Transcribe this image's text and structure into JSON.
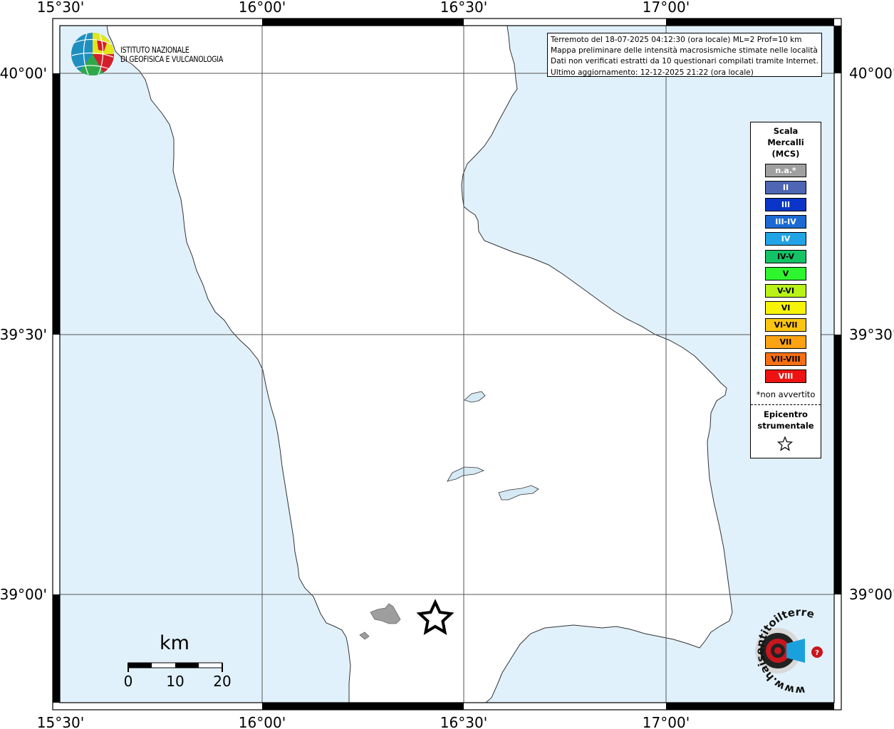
{
  "map": {
    "lon_labels": [
      "15°30'",
      "16°00'",
      "16°30'",
      "17°00'"
    ],
    "lat_labels": [
      "40°00'",
      "39°30'",
      "39°00'"
    ],
    "colors": {
      "sea": "#e1f1fb",
      "land": "#ffffff",
      "coast": "#333333",
      "lake": "#d6eaf5",
      "frame": "#000000"
    }
  },
  "logo": {
    "line1": "ISTITUTO NAZIONALE",
    "line2": "DI GEOFISICA E VULCANOLOGIA"
  },
  "info": {
    "line1": "Terremoto del 18-07-2025 04:12:30 (ora locale) ML=2 Prof=10 km",
    "line2": "Mappa preliminare delle intensità macrosismiche stimate nelle località",
    "line3": "Dati non verificati estratti da 10 questionari compilati tramite Internet.",
    "line4": "Ultimo aggiornamento: 12-12-2025 21:22 (ora locale)"
  },
  "legend": {
    "title1": "Scala",
    "title2": "Mercalli",
    "title3": "(MCS)",
    "items": [
      {
        "label": "n.a.*",
        "color": "#a0a0a0",
        "text_color": "#ffffff"
      },
      {
        "label": "II",
        "color": "#4f66b5",
        "text_color": "#ffffff"
      },
      {
        "label": "III",
        "color": "#0a35c8",
        "text_color": "#ffffff"
      },
      {
        "label": "III-IV",
        "color": "#1b6ad4",
        "text_color": "#ffffff"
      },
      {
        "label": "IV",
        "color": "#22a3e6",
        "text_color": "#ffffff"
      },
      {
        "label": "IV-V",
        "color": "#12c265",
        "text_color": "#000000"
      },
      {
        "label": "V",
        "color": "#2ef52e",
        "text_color": "#000000"
      },
      {
        "label": "V-VI",
        "color": "#b8f216",
        "text_color": "#000000"
      },
      {
        "label": "VI",
        "color": "#f7f307",
        "text_color": "#000000"
      },
      {
        "label": "VI-VII",
        "color": "#fbc512",
        "text_color": "#000000"
      },
      {
        "label": "VII",
        "color": "#fba314",
        "text_color": "#000000"
      },
      {
        "label": "VII-VIII",
        "color": "#f76f12",
        "text_color": "#000000"
      },
      {
        "label": "VIII",
        "color": "#ee1212",
        "text_color": "#ffffff"
      }
    ],
    "note": "*non avvertito",
    "epi1": "Epicentro",
    "epi2": "strumentale"
  },
  "scalebar": {
    "title": "km",
    "ticks": [
      "0",
      "10",
      "20"
    ]
  },
  "watermark": {
    "text": "www.haisentitoilterremoto.it"
  }
}
